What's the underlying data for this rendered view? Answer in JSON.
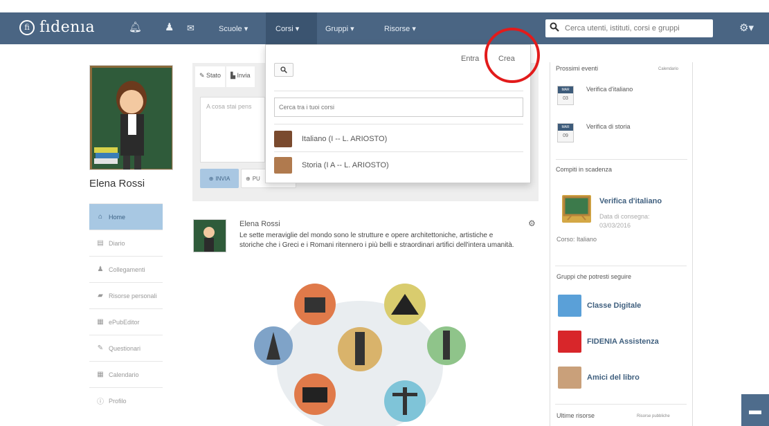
{
  "navbar": {
    "logo_mark": "fi",
    "logo_text": "fıdenıa",
    "menu": [
      {
        "label": "Scuole ▾"
      },
      {
        "label": "Corsi ▾"
      },
      {
        "label": "Gruppi ▾"
      },
      {
        "label": "Risorse ▾"
      }
    ],
    "search_placeholder": "Cerca utenti, istituti, corsi e gruppi",
    "settings_label": "⚙▾"
  },
  "profile": {
    "name": "Elena Rossi",
    "menu": [
      {
        "icon": "home-icon",
        "glyph": "⌂",
        "label": "Home"
      },
      {
        "icon": "diary-icon",
        "glyph": "▤",
        "label": "Diario"
      },
      {
        "icon": "user-icon",
        "glyph": "♟",
        "label": "Collegamenti"
      },
      {
        "icon": "folder-icon",
        "glyph": "▰",
        "label": "Risorse personali"
      },
      {
        "icon": "book-icon",
        "glyph": "▦",
        "label": "ePubEditor"
      },
      {
        "icon": "edit-icon",
        "glyph": "✎",
        "label": "Questionari"
      },
      {
        "icon": "calendar-icon",
        "glyph": "▦",
        "label": "Calendario"
      },
      {
        "icon": "info-icon",
        "glyph": "ⓘ",
        "label": "Profilo"
      }
    ]
  },
  "composer": {
    "tab_stato": "Stato",
    "tab_invia": "Invia",
    "placeholder": "A cosa stai pens",
    "invia_button": "INVIA",
    "second_button": "PU"
  },
  "corsi_dropdown": {
    "entra_label": "Entra",
    "crea_label": "Crea",
    "search_placeholder": "Cerca tra i tuoi corsi",
    "courses": [
      {
        "label": "Italiano (I -- L. ARIOSTO)"
      },
      {
        "label": "Storia (I A -- L. ARIOSTO)"
      }
    ]
  },
  "feed": {
    "author": "Elena Rossi",
    "text": "Le sette meraviglie del mondo sono le strutture e opere architettoniche, artistiche e storiche che i Greci e i Romani ritennero i più belli e straordinari artifici dell'intera umanità."
  },
  "right_sidebar": {
    "events_title": "Prossimi eventi",
    "calendar_link": "Calendario",
    "events": [
      {
        "month": "MAR",
        "day": "03",
        "title": "Verifica d'italiano"
      },
      {
        "month": "MAR",
        "day": "09",
        "title": "Verifica di storia"
      }
    ],
    "due_title": "Compiti in scadenza",
    "assignment": {
      "title": "Verifica d'italiano",
      "date_label": "Data di consegna:",
      "date": "03/03/2016",
      "course": "Corso: Italiano"
    },
    "groups_title": "Gruppi che potresti seguire",
    "groups": [
      {
        "name": "Classe Digitale"
      },
      {
        "name": "FIDENIA Assistenza"
      },
      {
        "name": "Amici del libro"
      }
    ],
    "resources_title": "Ultime risorse",
    "public_resources_link": "Risorse pubbliche"
  },
  "colors": {
    "navbar": "#4a6583",
    "accent": "#3f5f7e",
    "highlight_circle": "#e21b1b"
  }
}
